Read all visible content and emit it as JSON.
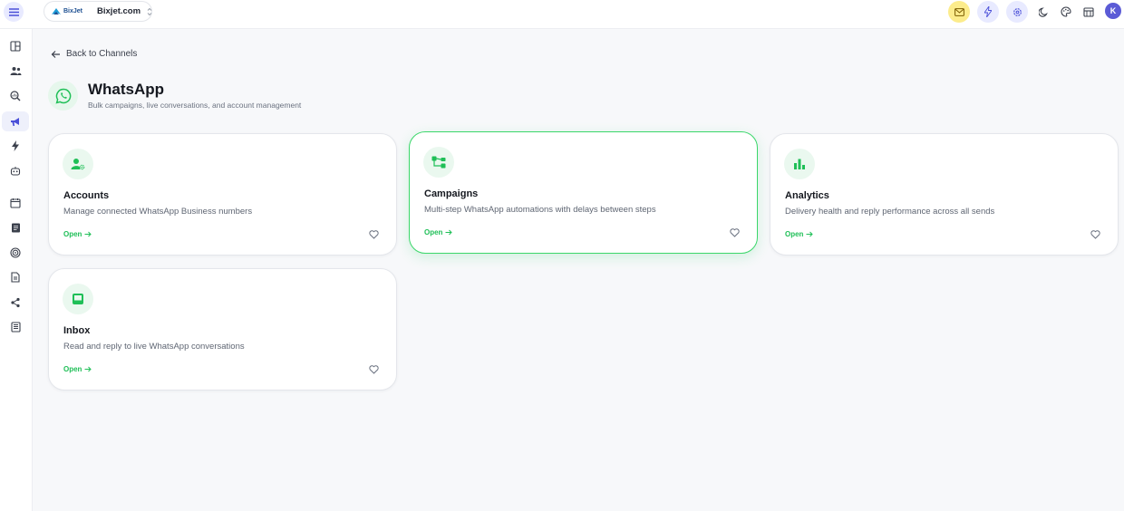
{
  "header": {
    "workspace": {
      "logo_text": "BixJet",
      "name": "Bixjet.com"
    },
    "avatar_initial": "K",
    "icons": [
      "mail-icon",
      "lightning-icon",
      "settings-icon",
      "moon-icon",
      "palette-icon",
      "store-icon"
    ],
    "colors": {
      "mail_bg": "#fcec8c",
      "action_bg": "#e8eaff",
      "avatar_bg": "#5b5bd6"
    }
  },
  "sidebar": {
    "items": [
      {
        "icon": "dashboard-icon"
      },
      {
        "icon": "users-icon"
      },
      {
        "icon": "search-analytics-icon"
      },
      {
        "icon": "megaphone-icon",
        "active": true
      },
      {
        "icon": "lightning-icon"
      },
      {
        "icon": "bot-icon"
      },
      {
        "icon": "calendar-icon"
      },
      {
        "icon": "clipboard-icon"
      },
      {
        "icon": "target-icon"
      },
      {
        "icon": "document-icon"
      },
      {
        "icon": "share-icon"
      },
      {
        "icon": "receipt-icon"
      }
    ]
  },
  "page": {
    "back_label": "Back to Channels",
    "title": "WhatsApp",
    "subtitle": "Bulk campaigns, live conversations, and account management",
    "accent": "#1fbf57"
  },
  "cards": [
    {
      "title": "Accounts",
      "description": "Manage connected WhatsApp Business numbers",
      "open_label": "Open",
      "icon": "user-settings-icon"
    },
    {
      "title": "Campaigns",
      "description": "Multi-step WhatsApp automations with delays between steps",
      "open_label": "Open",
      "icon": "workflow-icon"
    },
    {
      "title": "Analytics",
      "description": "Delivery health and reply performance across all sends",
      "open_label": "Open",
      "icon": "bar-chart-icon"
    },
    {
      "title": "Inbox",
      "description": "Read and reply to live WhatsApp conversations",
      "open_label": "Open",
      "icon": "inbox-icon"
    }
  ]
}
